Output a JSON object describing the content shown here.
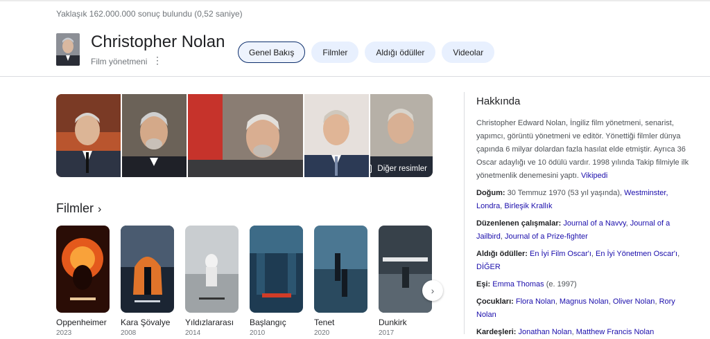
{
  "result_stats": "Yaklaşık 162.000.000 sonuç bulundu (0,52 saniye)",
  "entity": {
    "name": "Christopher Nolan",
    "subtitle": "Film yönetmeni"
  },
  "tabs": [
    {
      "label": "Genel Bakış",
      "active": true
    },
    {
      "label": "Filmler",
      "active": false
    },
    {
      "label": "Aldığı ödüller",
      "active": false
    },
    {
      "label": "Videolar",
      "active": false
    }
  ],
  "images": {
    "more_label": "Diğer resimler"
  },
  "films_section": {
    "heading": "Filmler",
    "items": [
      {
        "title": "Oppenheimer",
        "year": "2023"
      },
      {
        "title": "Kara Şövalye",
        "year": "2008"
      },
      {
        "title": "Yıldızlararası",
        "year": "2014"
      },
      {
        "title": "Başlangıç",
        "year": "2010"
      },
      {
        "title": "Tenet",
        "year": "2020"
      },
      {
        "title": "Dunkirk",
        "year": "2017"
      }
    ]
  },
  "about": {
    "title": "Hakkında",
    "description": "Christopher Edward Nolan, İngiliz film yönetmeni, senarist, yapımcı, görüntü yönetmeni ve editör. Yönettiği filmler dünya çapında 6 milyar dolardan fazla hasılat elde etmiştir. Ayrıca 36 Oscar adaylığı ve 10 ödülü vardır. 1998 yılında Takip filmiyle ilk yönetmenlik denemesini yaptı.",
    "source_link": "Vikipedi",
    "born": {
      "label": "Doğum:",
      "text": "30 Temmuz 1970 (53 yıl yaşında),",
      "link1": "Westminster, Londra",
      "sep": ", ",
      "link2": "Birleşik Krallık"
    },
    "works": {
      "label": "Düzenlenen çalışmalar:",
      "link1": "Journal of a Navvy",
      "sep": ", ",
      "link2": "Journal of a Jailbird",
      "link3": "Journal of a Prize-fighter"
    },
    "awards": {
      "label": "Aldığı ödüller:",
      "link1": "En İyi Film Oscar'ı",
      "link2": "En İyi Yönetmen Oscar'ı",
      "link3": "DİĞER"
    },
    "spouse": {
      "label": "Eşi:",
      "link": "Emma Thomas",
      "text": "(e. 1997)"
    },
    "children": {
      "label": "Çocukları:",
      "link1": "Flora Nolan",
      "link2": "Magnus Nolan",
      "link3": "Oliver Nolan",
      "link4": "Rory Nolan"
    },
    "siblings": {
      "label": "Kardeşleri:",
      "link1": "Jonathan Nolan",
      "link2": "Matthew Francis Nolan"
    }
  },
  "colors": {
    "link": "#1a0dab",
    "tab_bg": "#e8f0fe",
    "active_tab_border": "#0b2d6b"
  }
}
